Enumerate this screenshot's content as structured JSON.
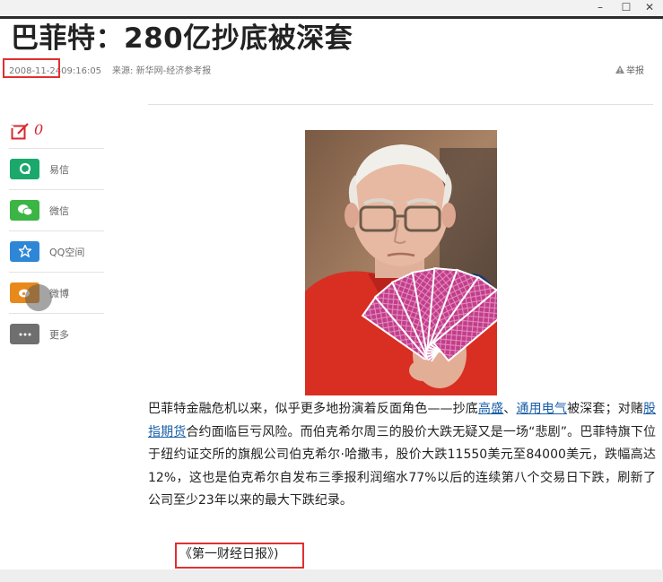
{
  "window": {
    "minimize_glyph": "–",
    "maximize_glyph": "☐",
    "close_glyph": "✕"
  },
  "article": {
    "title": "巴菲特：280亿抄底被深套",
    "date": "2008-11-24",
    "time": "09:16:05",
    "source_line": "来源: 新华网-经济参考报",
    "report_label": "举报",
    "paragraph": {
      "t1": "巴菲特金融危机以来，似乎更多地扮演着反面角色——抄底",
      "link1": "高盛",
      "t2": "、",
      "link2": "通用电气",
      "t3": "被深套；对赌",
      "link3": "股指期货",
      "t4": "合约面临巨亏风险。而伯克希尔周三的股价大跌无疑又是一场“悲剧”。巴菲特旗下位于纽约证交所的旗舰公司伯克希尔·哈撒韦，股价大跌11550美元至84000美元，跌幅高达12%，这也是伯克希尔自发布三季报利润缩水77%以后的连续第八个交易日下跌，刷新了公司至少23年以来的最大下跌纪录。"
    },
    "source_credit": "《第一财经日报》)"
  },
  "share": {
    "count": "0",
    "items": [
      {
        "label": "易信",
        "color": "#1aa86b",
        "icon": "yixin-icon"
      },
      {
        "label": "微信",
        "color": "#3bb544",
        "icon": "wechat-icon"
      },
      {
        "label": "QQ空间",
        "color": "#2e86d6",
        "icon": "qzone-star-icon"
      },
      {
        "label": "微博",
        "color": "#e8891c",
        "icon": "weibo-icon"
      },
      {
        "label": "更多",
        "color": "#6f6f6f",
        "icon": "more-dots-icon"
      }
    ]
  },
  "colors": {
    "accent_red": "#d9272e",
    "highlight_box": "#e03030",
    "link": "#1a5fa8"
  }
}
